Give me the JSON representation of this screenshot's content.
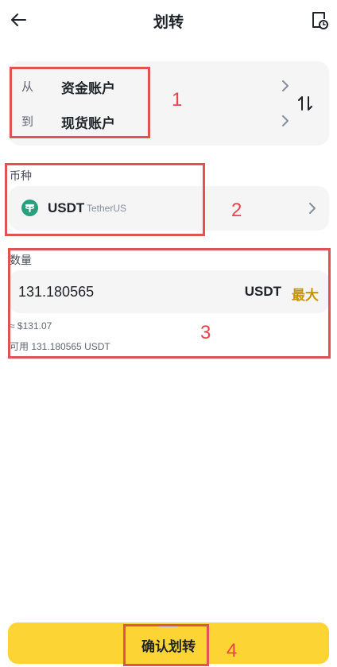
{
  "header": {
    "title": "划转",
    "back_icon": "arrow-left-icon",
    "history_icon": "document-clock-icon"
  },
  "transfer": {
    "from_label": "从",
    "from_account": "资金账户",
    "to_label": "到",
    "to_account": "现货账户",
    "swap_icon": "swap-vertical-icon"
  },
  "coin": {
    "section_label": "币种",
    "symbol": "USDT",
    "name": "TetherUS",
    "logo_color": "#26a17b"
  },
  "amount": {
    "section_label": "数量",
    "value": "131.180565",
    "unit": "USDT",
    "max_label": "最大",
    "fiat_value": "≈ $131.07",
    "available": "可用 131.180565 USDT"
  },
  "footer": {
    "confirm_label": "确认划转"
  },
  "annotations": [
    "1",
    "2",
    "3",
    "4"
  ],
  "colors": {
    "accent": "#fcd535",
    "max": "#c99400",
    "annotation": "#e05353",
    "card": "#f5f5f5"
  }
}
